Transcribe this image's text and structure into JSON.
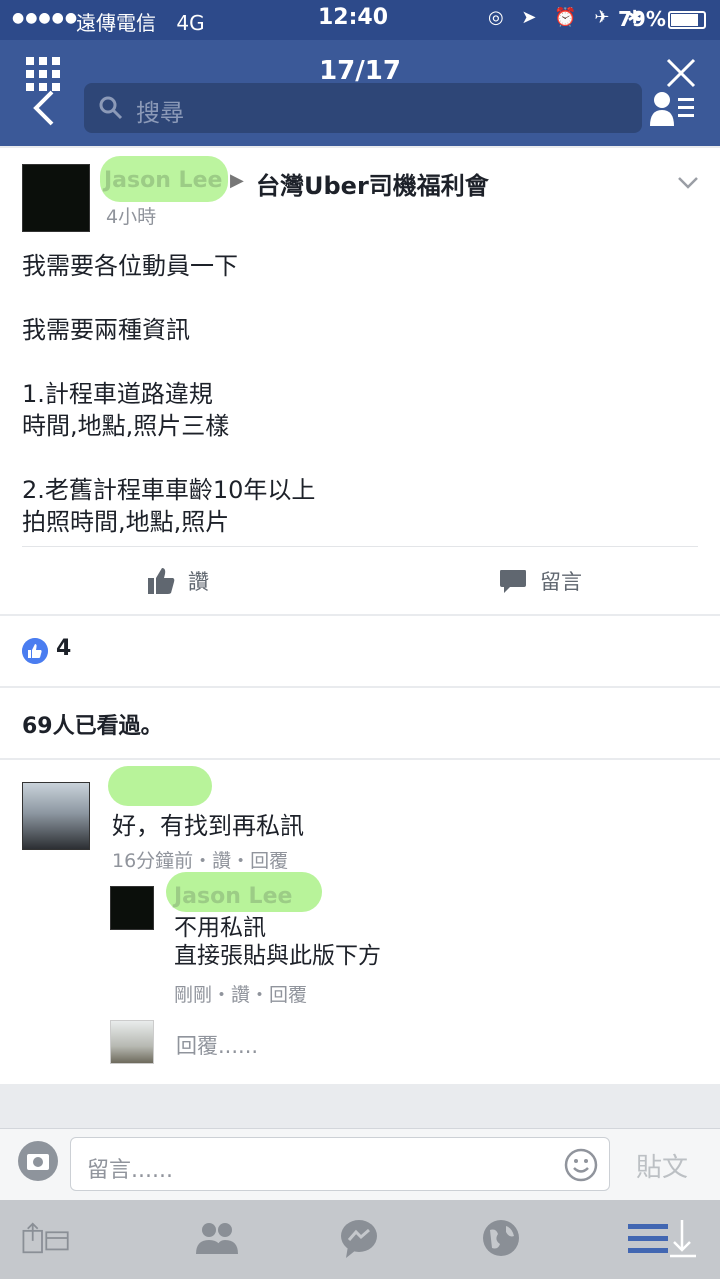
{
  "status_bar": {
    "carrier": "遠傳電信",
    "network": "4G",
    "time": "12:40",
    "battery": "79%",
    "battery_level": 0.79
  },
  "header": {
    "counter": "17/17",
    "search_placeholder": "搜尋"
  },
  "post": {
    "author": "Jason Lee",
    "group": "台灣Uber司機福利會",
    "time": "4小時",
    "body_lines": [
      "我需要各位動員一下",
      "",
      "我需要兩種資訊",
      "",
      "1.計程車道路違規",
      "時間,地點,照片三樣",
      "",
      "2.老舊計程車車齡10年以上",
      "拍照時間,地點,照片"
    ],
    "like_label": "讚",
    "comment_label": "留言"
  },
  "reactions": {
    "count": "4"
  },
  "seen": {
    "text": "69人已看過。"
  },
  "comments": [
    {
      "text": "好，有找到再私訊",
      "meta": "16分鐘前・讚・回覆"
    },
    {
      "author": "Jason Lee",
      "lines": [
        "不用私訊",
        "直接張貼與此版下方"
      ],
      "meta": "剛剛・讚・回覆"
    }
  ],
  "reply_placeholder": "回覆......",
  "composer": {
    "placeholder": "留言......",
    "post_label": "貼文"
  },
  "colors": {
    "header_blue": "#3b5998",
    "like_blue": "#4a7df0",
    "highlight_green": "#b8f39a"
  },
  "icons": [
    "grid-icon",
    "close-icon",
    "back-icon",
    "search-icon",
    "friends-icon",
    "chevron-down-icon",
    "thumbs-up-icon",
    "comment-icon",
    "camera-icon",
    "smile-icon",
    "share-icon",
    "people-icon",
    "messenger-icon",
    "globe-icon",
    "menu-icon"
  ]
}
